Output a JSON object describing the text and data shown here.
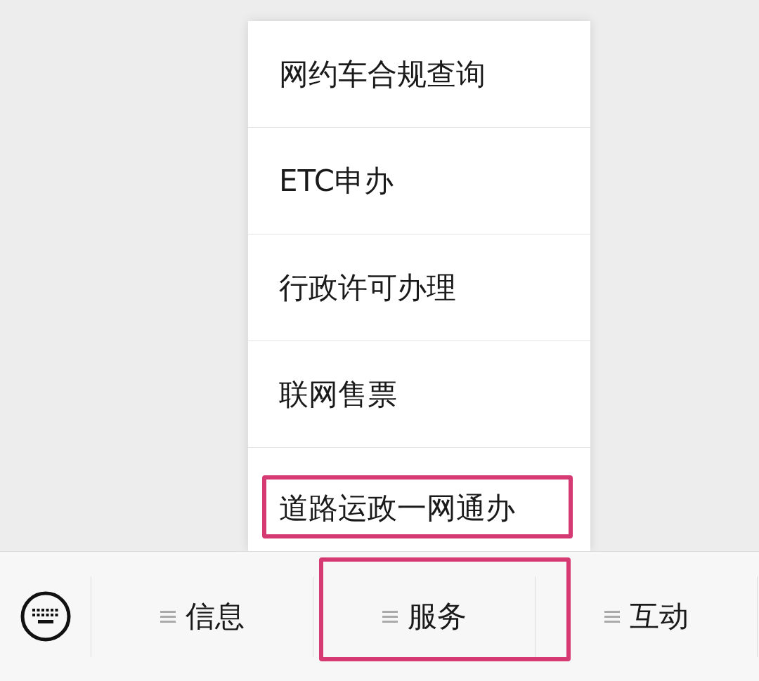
{
  "menu_popup": {
    "items": [
      {
        "label": "网约车合规查询",
        "highlighted": false
      },
      {
        "label": "ETC申办",
        "highlighted": false
      },
      {
        "label": "行政许可办理",
        "highlighted": false
      },
      {
        "label": "联网售票",
        "highlighted": false
      },
      {
        "label": "道路运政一网通办",
        "highlighted": true
      }
    ]
  },
  "bottom_bar": {
    "tabs": [
      {
        "label": "信息",
        "highlighted": false
      },
      {
        "label": "服务",
        "highlighted": true
      },
      {
        "label": "互动",
        "highlighted": false
      }
    ]
  }
}
